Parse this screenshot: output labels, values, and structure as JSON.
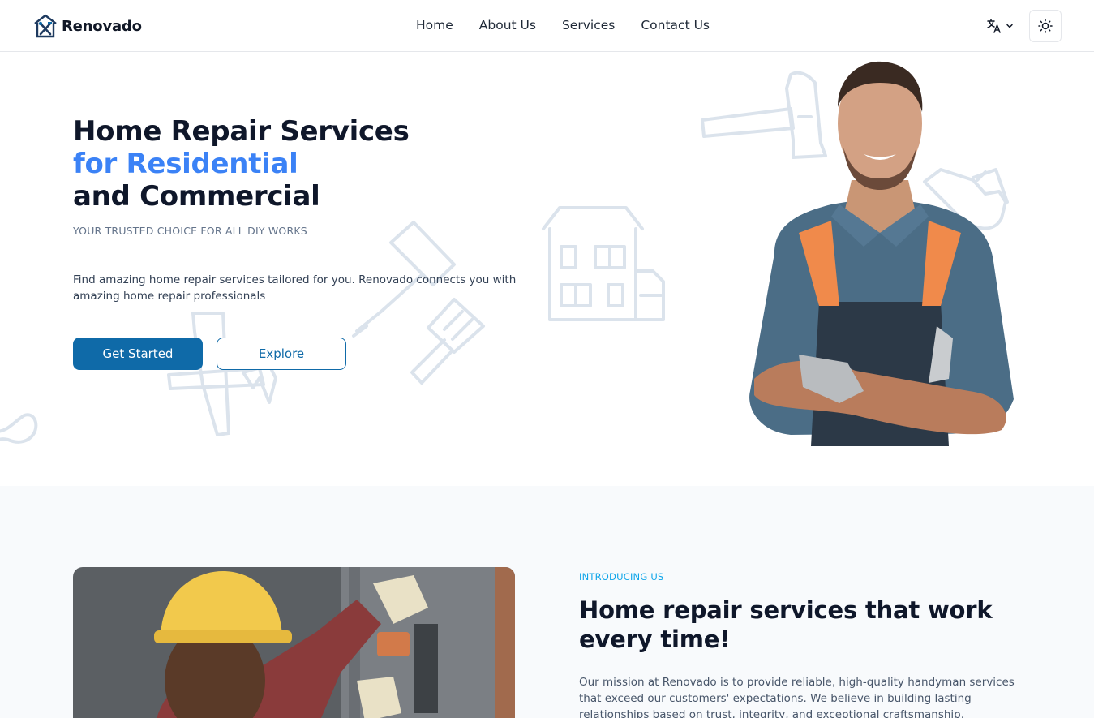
{
  "header": {
    "brand": "Renovado",
    "nav": [
      "Home",
      "About Us",
      "Services",
      "Contact Us"
    ]
  },
  "hero": {
    "title_line1": "Home Repair Services",
    "title_line2": "for Residential",
    "title_line3": "and Commercial",
    "subtitle": "YOUR TRUSTED CHOICE FOR ALL DIY WORKS",
    "description": "Find amazing home repair services tailored for you. Renovado connects you with amazing home repair professionals",
    "primary_button": "Get Started",
    "secondary_button": "Explore"
  },
  "about": {
    "kicker": "INTRODUCING US",
    "title": "Home repair services that work every time!",
    "description": "Our mission at Renovado is to provide reliable, high-quality handyman services that exceed our customers' expectations. We believe in building lasting relationships based on trust, integrity, and exceptional craftsmanship."
  },
  "colors": {
    "primary": "#0f6aa8",
    "accent": "#3b82f6",
    "kicker": "#0ea5e9",
    "section_bg": "#f8fafc"
  },
  "icons": {
    "logo": "house-tools-icon",
    "language": "translate-icon",
    "language_caret": "chevron-down-icon",
    "theme": "sun-icon"
  }
}
